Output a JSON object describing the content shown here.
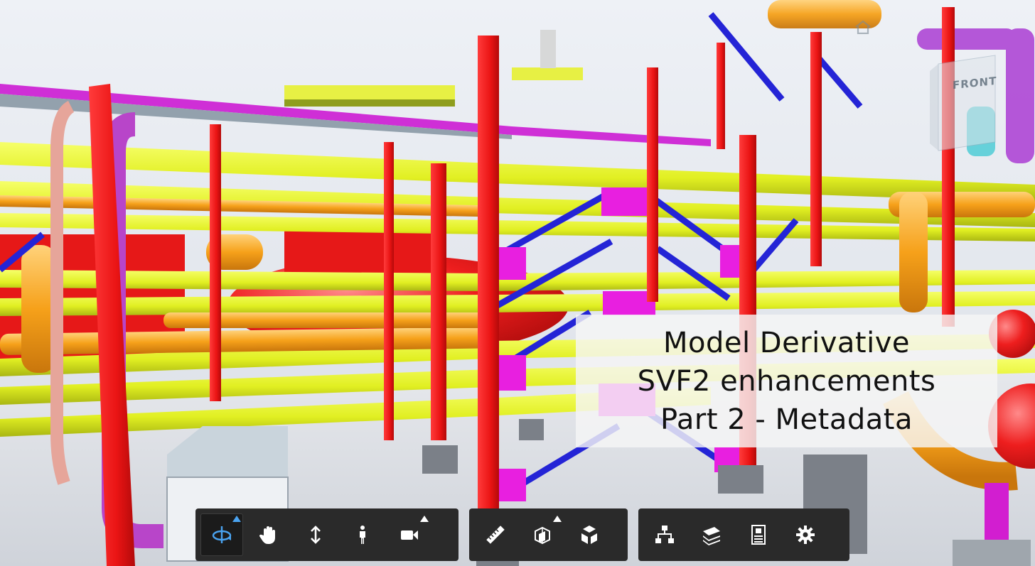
{
  "overlay": {
    "line1": "Model Derivative",
    "line2": "SVF2 enhancements",
    "line3": "Part 2 - Metadata"
  },
  "viewcube": {
    "face_label": "FRONT"
  },
  "toolbar": {
    "groups": [
      {
        "name": "navigation",
        "tools": [
          "orbit",
          "pan",
          "zoom",
          "first-person",
          "camera"
        ]
      },
      {
        "name": "modeling",
        "tools": [
          "measure",
          "section-analysis",
          "explode-model"
        ]
      },
      {
        "name": "settings",
        "tools": [
          "model-browser",
          "properties-layers",
          "properties",
          "settings"
        ]
      }
    ],
    "active_tool": "orbit"
  },
  "colors": {
    "structure_red": "#ef1c1c",
    "beam_yellow": "#e4f230",
    "pipe_orange": "#f9a71e",
    "pipe_magenta": "#d11fd3",
    "brace_blue": "#2323d8",
    "toolbar_bg": "#2a2a2a",
    "active_blue": "#4aa3f0"
  }
}
